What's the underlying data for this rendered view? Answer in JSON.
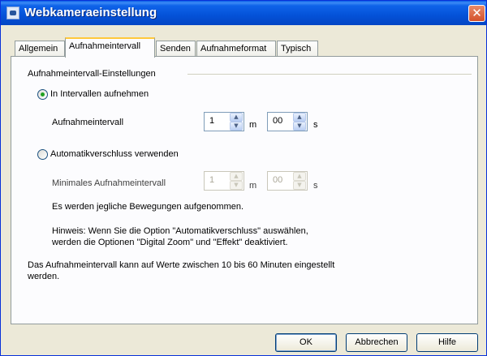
{
  "window": {
    "title": "Webkameraeinstellung",
    "close_glyph": "✕"
  },
  "tabs": [
    {
      "label": "Allgemein"
    },
    {
      "label": "Aufnahmeintervall"
    },
    {
      "label": "Senden"
    },
    {
      "label": "Aufnahmeformat"
    },
    {
      "label": "Typisch"
    }
  ],
  "group_title": "Aufnahmeintervall-Einstellungen",
  "option_interval": {
    "label": "In Intervallen aufnehmen",
    "selected": true,
    "field_label": "Aufnahmeintervall",
    "minutes": "1",
    "minutes_unit": "m",
    "seconds": "00",
    "seconds_unit": "s"
  },
  "option_auto": {
    "label": "Automatikverschluss verwenden",
    "selected": false,
    "field_label": "Minimales Aufnahmeintervall",
    "minutes": "1",
    "minutes_unit": "m",
    "seconds": "00",
    "seconds_unit": "s",
    "description": "Es werden jegliche Bewegungen aufgenommen.",
    "hint_line1": "Hinweis: Wenn Sie die Option \"Automatikverschluss\" auswählen,",
    "hint_line2": "werden die Optionen \"Digital Zoom\" und \"Effekt\" deaktiviert."
  },
  "footer_note_line1": "Das Aufnahmeintervall kann auf Werte zwischen 10 bis 60 Minuten eingestellt",
  "footer_note_line2": "werden.",
  "buttons": {
    "ok": "OK",
    "cancel": "Abbrechen",
    "help": "Hilfe"
  },
  "icons": {
    "spin_up": "▲",
    "spin_down": "▼"
  }
}
